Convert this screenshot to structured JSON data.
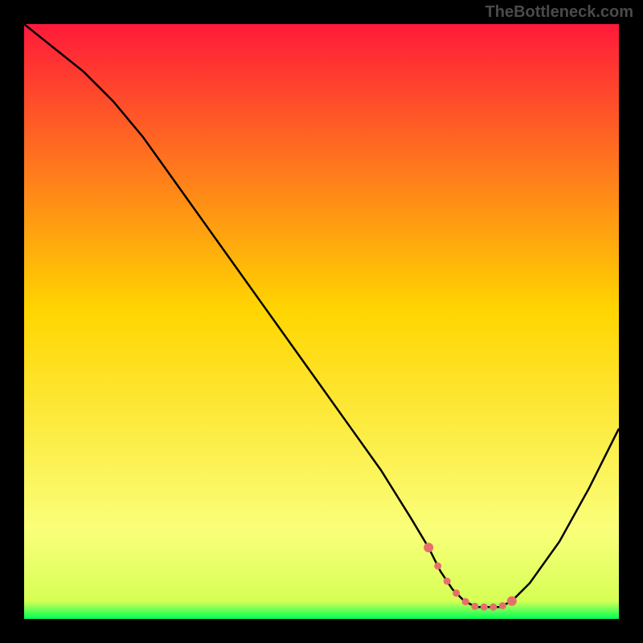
{
  "watermark": "TheBottleneck.com",
  "colors": {
    "background": "#000000",
    "gradient_top": "#ff1a3a",
    "gradient_mid": "#ffd500",
    "gradient_low": "#faff7a",
    "gradient_bottom": "#00ff55",
    "curve": "#000000",
    "marker": "#e5706b"
  },
  "chart_data": {
    "type": "line",
    "title": "",
    "xlabel": "",
    "ylabel": "",
    "xlim": [
      0,
      100
    ],
    "ylim": [
      0,
      100
    ],
    "grid": false,
    "series": [
      {
        "name": "bottleneck-curve",
        "x": [
          0,
          5,
          10,
          15,
          20,
          25,
          30,
          35,
          40,
          45,
          50,
          55,
          60,
          65,
          68,
          70,
          72,
          74,
          76,
          78,
          80,
          82,
          85,
          90,
          95,
          100
        ],
        "values": [
          100,
          96,
          92,
          87,
          81,
          74,
          67,
          60,
          53,
          46,
          39,
          32,
          25,
          17,
          12,
          8,
          5,
          3,
          2,
          2,
          2,
          3,
          6,
          13,
          22,
          32
        ]
      }
    ],
    "highlight_region": {
      "x_start": 68,
      "x_end": 82,
      "note": "optimal-range-dotted-markers"
    }
  }
}
